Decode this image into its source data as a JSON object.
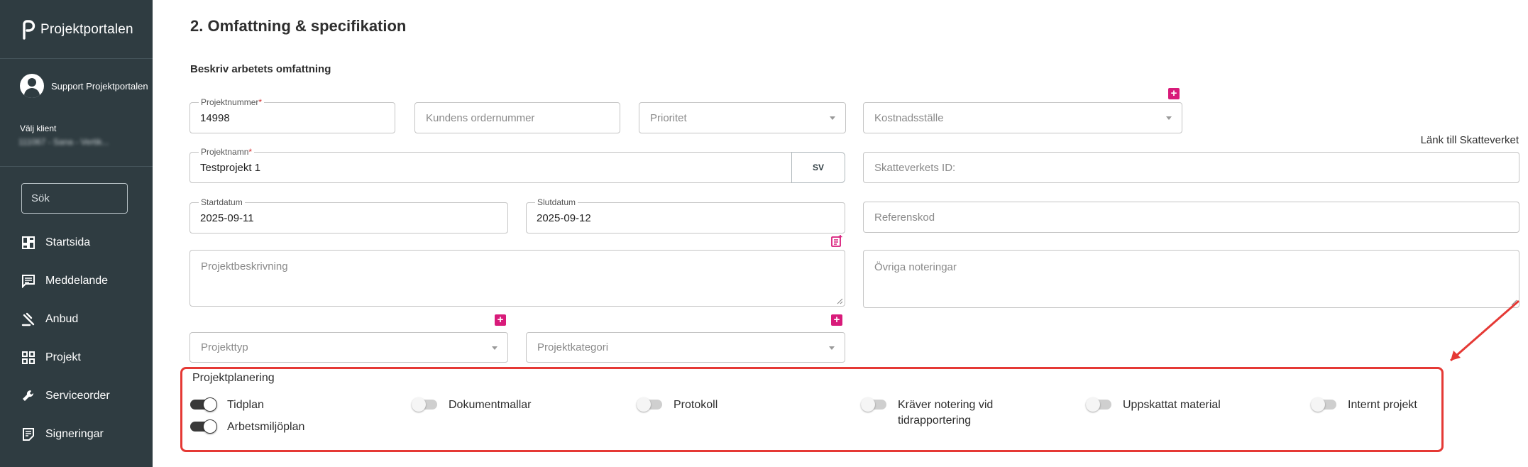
{
  "app": {
    "logo_text": "Projektportalen"
  },
  "user": {
    "name": "Support Projektportalen"
  },
  "client": {
    "label": "Välj klient",
    "value": "111067 - Sana - Vertik..."
  },
  "search": {
    "placeholder": "Sök"
  },
  "nav": [
    {
      "label": "Startsida",
      "icon": "dashboard-icon"
    },
    {
      "label": "Meddelande",
      "icon": "message-icon"
    },
    {
      "label": "Anbud",
      "icon": "gavel-icon"
    },
    {
      "label": "Projekt",
      "icon": "project-grid-icon"
    },
    {
      "label": "Serviceorder",
      "icon": "wrench-icon"
    },
    {
      "label": "Signeringar",
      "icon": "sign-doc-icon"
    }
  ],
  "page": {
    "title": "2. Omfattning & specifikation",
    "subtitle": "Beskriv arbetets omfattning",
    "link_skatteverket": "Länk till Skatteverket"
  },
  "form": {
    "projektnummer": {
      "label": "Projektnummer",
      "required": "*",
      "value": "14998"
    },
    "kundens_ordernummer": {
      "placeholder": "Kundens ordernummer"
    },
    "prioritet": {
      "placeholder": "Prioritet"
    },
    "kostnadsstalle": {
      "placeholder": "Kostnadsställe"
    },
    "projektnamn": {
      "label": "Projektnamn",
      "required": "*",
      "value": "Testprojekt 1",
      "lang_button": "SV"
    },
    "skatteverkets_id": {
      "placeholder": "Skatteverkets ID:"
    },
    "startdatum": {
      "label": "Startdatum",
      "value": "2025-09-11"
    },
    "slutdatum": {
      "label": "Slutdatum",
      "value": "2025-09-12"
    },
    "referenskod": {
      "placeholder": "Referenskod"
    },
    "projektbeskrivning": {
      "placeholder": "Projektbeskrivning"
    },
    "ovriga_noteringar": {
      "placeholder": "Övriga noteringar"
    },
    "projekttyp": {
      "placeholder": "Projekttyp"
    },
    "projektkategori": {
      "placeholder": "Projektkategori"
    }
  },
  "planning": {
    "title": "Projektplanering",
    "toggles": {
      "tidplan": {
        "label": "Tidplan",
        "on": true
      },
      "arbetsmiljoplan": {
        "label": "Arbetsmiljöplan",
        "on": true
      },
      "dokumentmallar": {
        "label": "Dokumentmallar",
        "on": false
      },
      "protokoll": {
        "label": "Protokoll",
        "on": false
      },
      "kraver_notering": {
        "label": "Kräver notering vid tidrapportering",
        "on": false
      },
      "uppskattat_material": {
        "label": "Uppskattat material",
        "on": false
      },
      "internt_projekt": {
        "label": "Internt projekt",
        "on": false
      }
    }
  },
  "colors": {
    "sidebar": "#2f3c41",
    "accent_plus": "#d81b7a",
    "highlight": "#e53935"
  }
}
